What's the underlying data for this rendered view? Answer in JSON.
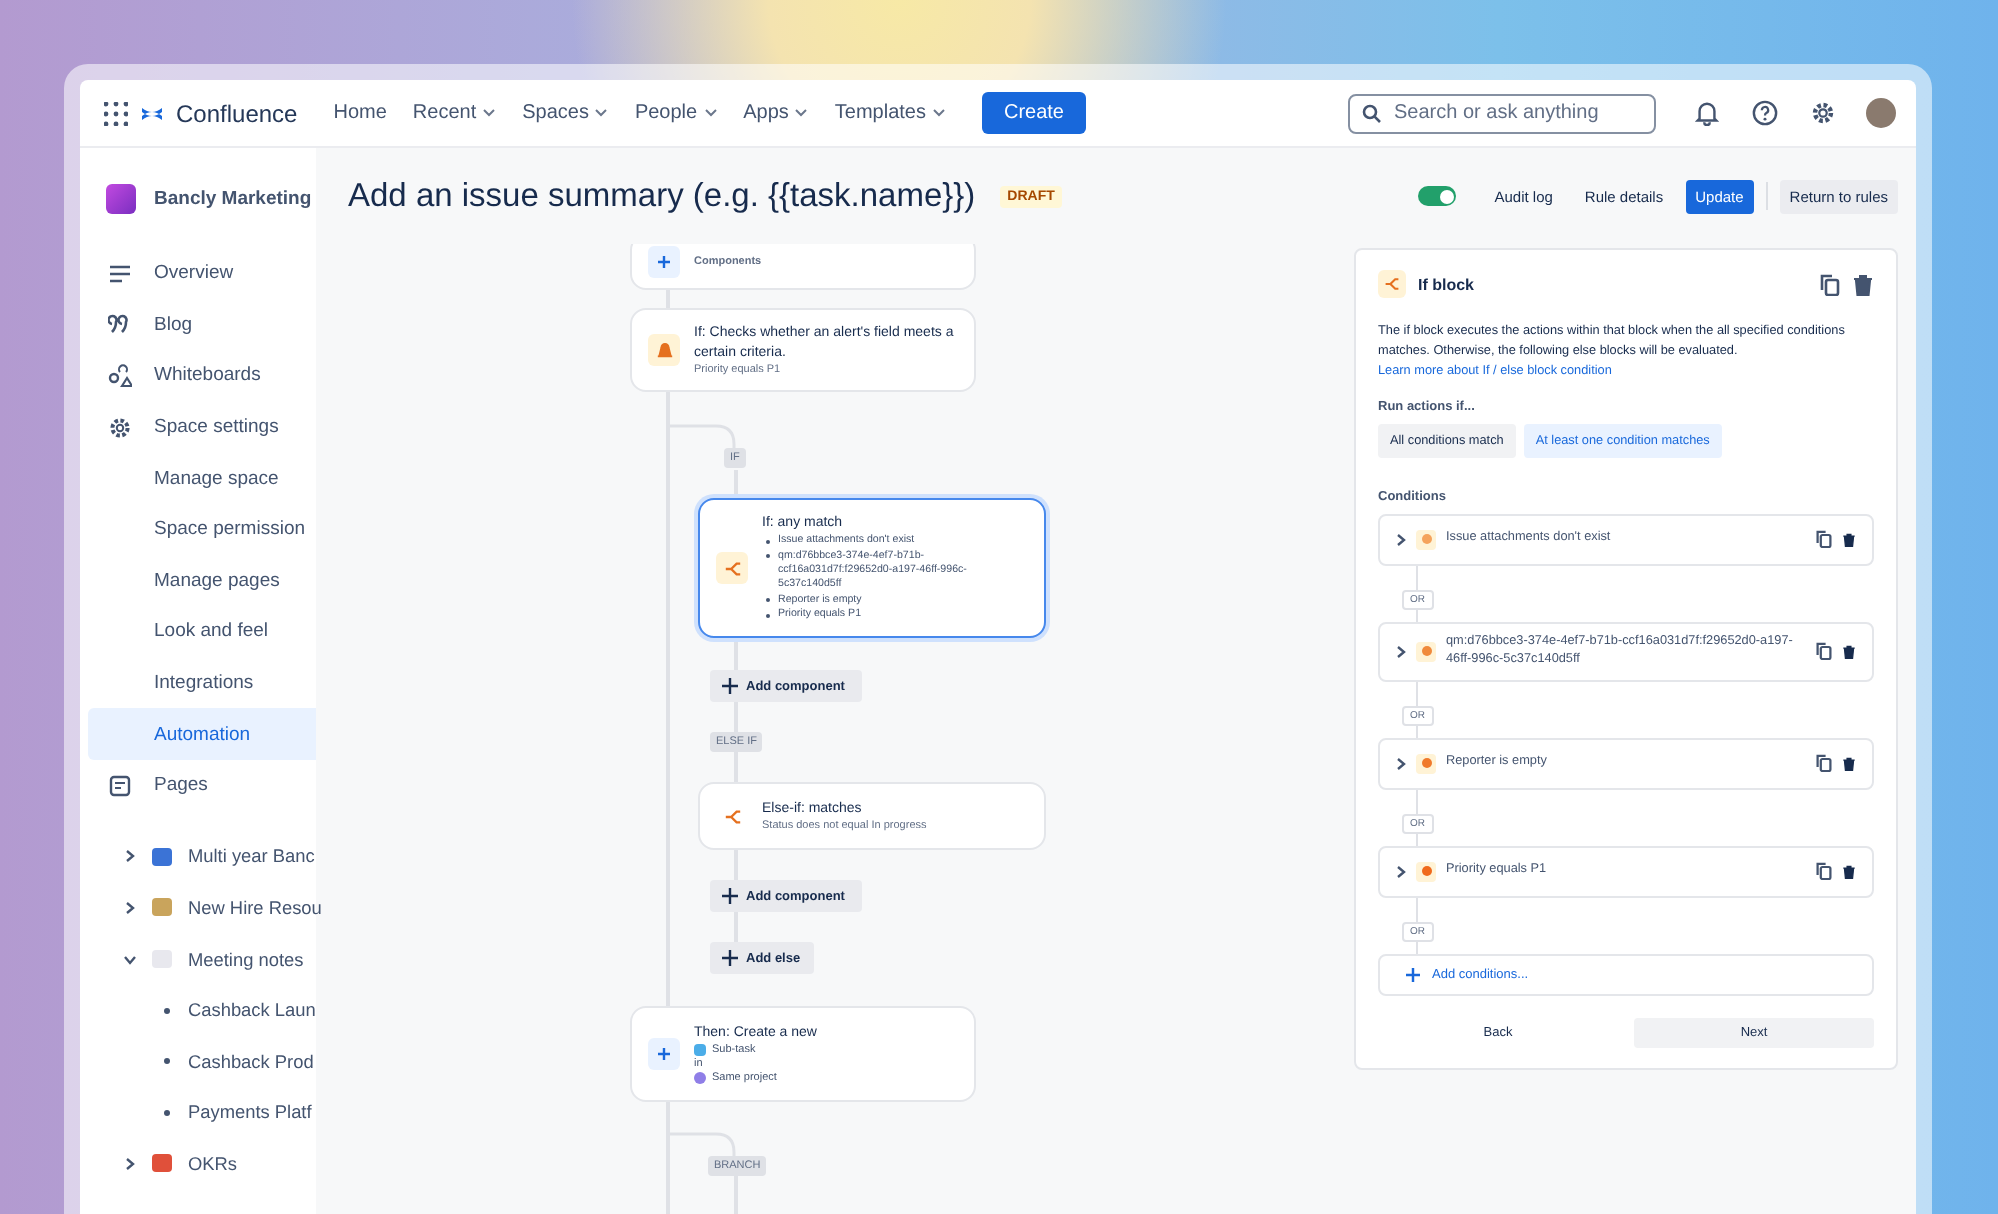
{
  "nav": {
    "app_name": "Confluence",
    "links": [
      {
        "label": "Home",
        "dropdown": false
      },
      {
        "label": "Recent",
        "dropdown": true
      },
      {
        "label": "Spaces",
        "dropdown": true
      },
      {
        "label": "People",
        "dropdown": true
      },
      {
        "label": "Apps",
        "dropdown": true
      },
      {
        "label": "Templates",
        "dropdown": true
      }
    ],
    "create": "Create",
    "search": {
      "placeholder": "Search or ask anything"
    }
  },
  "sidebar": {
    "space_name": "Bancly Marketing",
    "items": [
      {
        "label": "Overview",
        "selected": false
      },
      {
        "label": "Blog",
        "selected": false
      },
      {
        "label": "Whiteboards",
        "selected": false
      },
      {
        "label": "Space settings",
        "selected": false,
        "children": [
          {
            "label": "Manage space",
            "selected": false
          },
          {
            "label": "Space permission",
            "selected": false
          },
          {
            "label": "Manage pages",
            "selected": false
          },
          {
            "label": "Look and feel",
            "selected": false
          },
          {
            "label": "Integrations",
            "selected": false
          },
          {
            "label": "Automation",
            "selected": true
          }
        ]
      },
      {
        "label": "Pages",
        "selected": false
      }
    ],
    "page_tree": [
      {
        "label": "Multi year Banc",
        "expanded": false
      },
      {
        "label": "New Hire Resou",
        "expanded": false
      },
      {
        "label": "Meeting notes",
        "expanded": true,
        "children": [
          {
            "label": "Cashback Laun"
          },
          {
            "label": "Cashback Prod"
          },
          {
            "label": "Payments Platf"
          }
        ]
      },
      {
        "label": "OKRs",
        "expanded": false
      }
    ]
  },
  "header": {
    "title": "Add an issue summary (e.g. {{task.name}})",
    "status": "DRAFT",
    "rule_enabled": true,
    "audit_log": "Audit log",
    "rule_details": "Rule details",
    "update": "Update",
    "return": "Return to rules"
  },
  "flow": {
    "items": [
      {
        "kind": "node",
        "selected": false,
        "subtitle": "Components"
      },
      {
        "kind": "node",
        "selected": false,
        "title": "If: Checks whether an alert's field meets a certain criteria.",
        "subtitle": "Priority equals P1"
      },
      {
        "kind": "badge",
        "label": "IF"
      },
      {
        "kind": "node",
        "selected": true,
        "title": "If: any match",
        "bullets": [
          "Issue attachments don't exist",
          "qm:d76bbce3-374e-4ef7-b71b-ccf16a031d7f:f29652d0-a197-46ff-996c-5c37c140d5ff",
          "Reporter is empty",
          "Priority equals P1"
        ]
      },
      {
        "kind": "add",
        "label": "Add component"
      },
      {
        "kind": "badge",
        "label": "ELSE IF"
      },
      {
        "kind": "node",
        "selected": false,
        "title": "Else-if: matches",
        "subtitle": "Status does not equal In progress"
      },
      {
        "kind": "add",
        "label": "Add component"
      },
      {
        "kind": "add",
        "label": "Add else"
      },
      {
        "kind": "node",
        "selected": false,
        "title": "Then: Create a new",
        "details": [
          "Sub-task",
          "in",
          "Same project"
        ]
      },
      {
        "kind": "badge",
        "label": "BRANCH"
      }
    ]
  },
  "panel": {
    "title": "If block",
    "description": "The if block executes the actions within that block when the all specified conditions matches. Otherwise, the following else blocks will be evaluated.",
    "link": "Learn more about If / else block condition",
    "run_label": "Run actions if...",
    "options": [
      {
        "label": "All conditions match",
        "selected": false
      },
      {
        "label": "At least one condition matches",
        "selected": true
      }
    ],
    "conditions_label": "Conditions",
    "conditions": [
      {
        "text": "Issue attachments don't exist",
        "or": "OR"
      },
      {
        "text": "qm:d76bbce3-374e-4ef7-b71b-ccf16a031d7f:f29652d0-a197-46ff-996c-5c37c140d5ff",
        "or": "OR"
      },
      {
        "text": "Reporter is empty",
        "or": "OR"
      },
      {
        "text": "Priority equals P1",
        "or": "OR"
      }
    ],
    "add_conditions": "Add conditions...",
    "back": "Back",
    "next": "Next"
  }
}
